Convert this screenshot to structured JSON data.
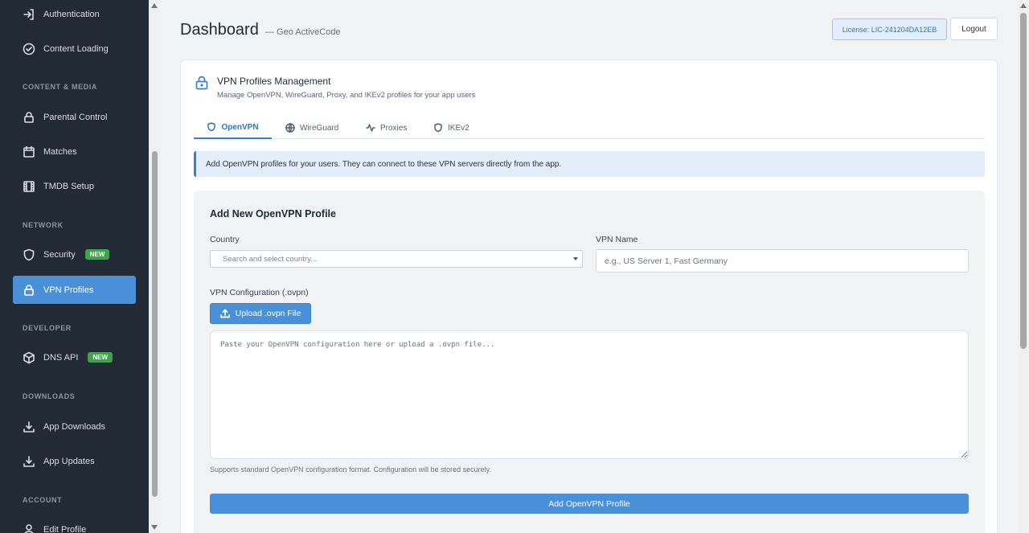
{
  "sidebar": {
    "items": [
      {
        "label": "Authentication",
        "icon": "login-icon"
      },
      {
        "label": "Content Loading",
        "icon": "check-circle-icon"
      },
      {
        "label": "Parental Control",
        "icon": "lock-icon"
      },
      {
        "label": "Matches",
        "icon": "calendar-icon"
      },
      {
        "label": "TMDB Setup",
        "icon": "film-icon"
      },
      {
        "label": "Security",
        "icon": "shield-icon",
        "badge": "NEW"
      },
      {
        "label": "VPN Profiles",
        "icon": "lock-icon",
        "active": true
      },
      {
        "label": "DNS API",
        "icon": "cube-icon",
        "badge": "NEW"
      },
      {
        "label": "App Downloads",
        "icon": "download-icon"
      },
      {
        "label": "App Updates",
        "icon": "download-icon"
      },
      {
        "label": "Edit Profile",
        "icon": "user-icon"
      }
    ],
    "sections": [
      "CONTENT & MEDIA",
      "NETWORK",
      "DEVELOPER",
      "DOWNLOADS",
      "ACCOUNT"
    ]
  },
  "header": {
    "title": "Dashboard",
    "subtitle": "— Geo ActiveCode",
    "license": "License: LIC-241204DA12EB",
    "logout": "Logout"
  },
  "card": {
    "title": "VPN Profiles Management",
    "description": "Manage OpenVPN, WireGuard, Proxy, and IKEv2 profiles for your app users",
    "tabs": [
      {
        "label": "OpenVPN",
        "icon": "shield-icon",
        "active": true
      },
      {
        "label": "WireGuard",
        "icon": "globe-icon"
      },
      {
        "label": "Proxies",
        "icon": "activity-icon"
      },
      {
        "label": "IKEv2",
        "icon": "shield-icon"
      }
    ],
    "info": "Add OpenVPN profiles for your users. They can connect to these VPN servers directly from the app."
  },
  "form": {
    "title": "Add New OpenVPN Profile",
    "country_label": "Country",
    "country_placeholder": "Search and select country...",
    "name_label": "VPN Name",
    "name_placeholder": "e.g., US Server 1, Fast Germany",
    "config_label": "VPN Configuration (.ovpn)",
    "upload_label": "Upload .ovpn File",
    "config_placeholder": "Paste your OpenVPN configuration here or upload a .ovpn file...",
    "hint": "Supports standard OpenVPN configuration format. Configuration will be stored securely.",
    "submit": "Add OpenVPN Profile"
  },
  "colors": {
    "sidebar_bg": "#222a35",
    "accent": "#4a90d9",
    "badge_new": "#3fa34d"
  }
}
